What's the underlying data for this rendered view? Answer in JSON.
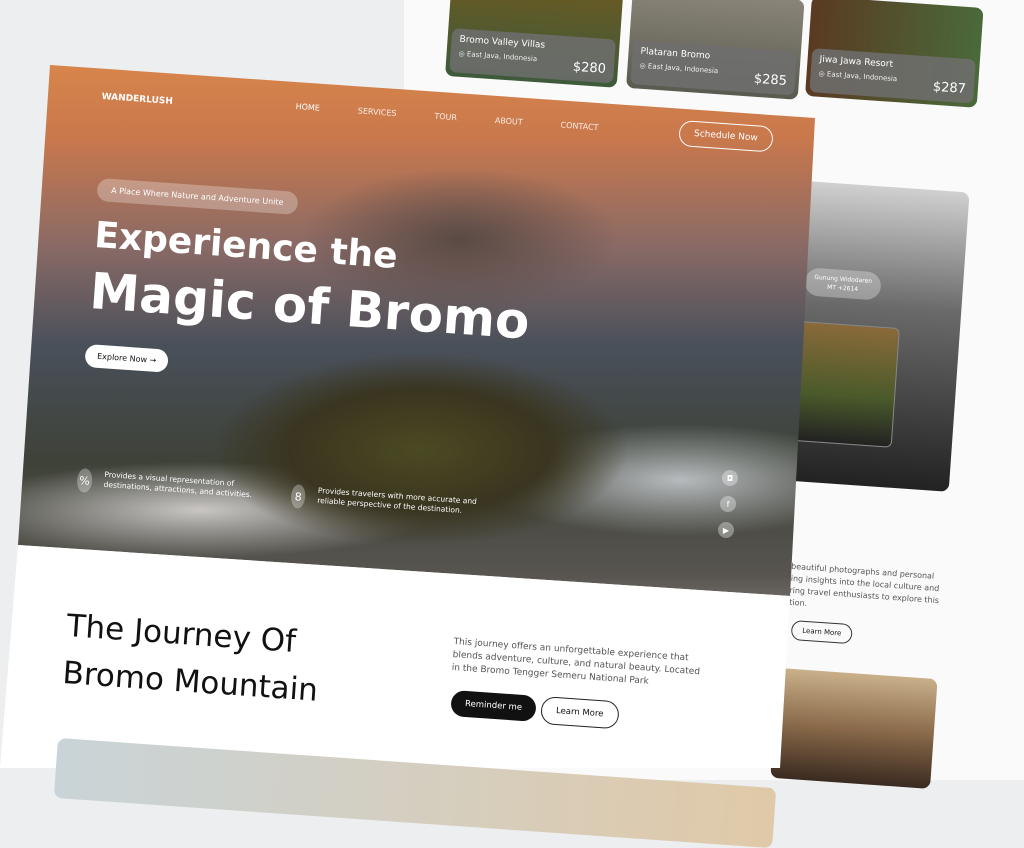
{
  "hotels": [
    {
      "name": "Bromo Valley Villas",
      "location": "East Java, Indonesia",
      "price": "$280"
    },
    {
      "name": "Plataran Bromo",
      "location": "East Java, Indonesia",
      "price": "$285"
    },
    {
      "name": "Jiwa Jawa Resort",
      "location": "East Java, Indonesia",
      "price": "$287"
    }
  ],
  "gallery": {
    "place": "Gunung Widodaren",
    "altitude": "MT +2614"
  },
  "side_text": "es beautiful photographs and personal viding insights into the local culture and spiring travel enthusiasts to explore this ination.",
  "side_learn_more": "Learn More",
  "nav": {
    "brand": "WANDERLUSH",
    "items": [
      "HOME",
      "SERVICES",
      "TOUR",
      "ABOUT",
      "CONTACT"
    ],
    "cta": "Schedule Now"
  },
  "hero": {
    "tagline": "A Place Where Nature and Adventure Unite",
    "title_line1": "Experience the",
    "title_line2": "Magic of Bromo",
    "explore": "Explore Now",
    "features": [
      "Provides a visual representation of destinations, attractions, and activities.",
      "Provides travelers with more accurate and reliable perspective of the destination."
    ]
  },
  "journey": {
    "title_line1": "The Journey Of",
    "title_line2": "Bromo Mountain",
    "text": "This journey offers an unforgettable experience that blends adventure, culture, and natural beauty. Located in the Bromo Tengger Semeru National Park",
    "reminder": "Reminder me",
    "learn_more": "Learn More"
  }
}
